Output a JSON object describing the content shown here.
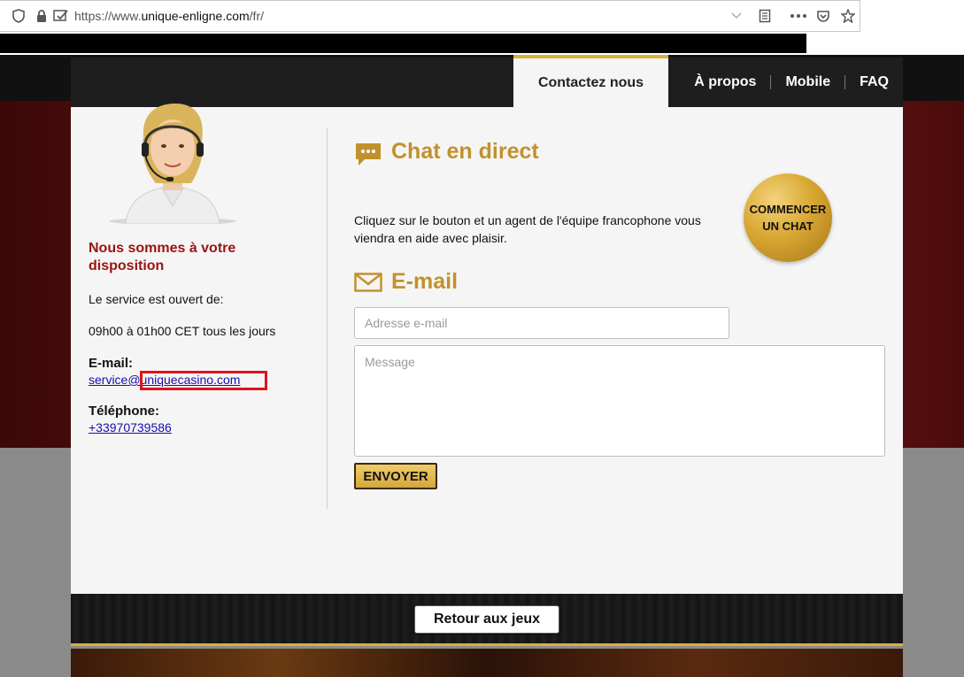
{
  "browser": {
    "url_prefix": "https://www.",
    "url_domain": "unique-enligne.com",
    "url_path": "/fr/"
  },
  "nav": {
    "active": "Contactez nous",
    "items": [
      "À propos",
      "Mobile",
      "FAQ"
    ]
  },
  "left": {
    "title": "Nous sommes à votre disposition",
    "service_open": "Le service est ouvert de:",
    "hours": "09h00 à 01h00 CET tous les jours",
    "email_label": "E-mail:",
    "email_value": "service@uniquecasino.com",
    "phone_label": "Téléphone:",
    "phone_value": "+33970739586"
  },
  "chat": {
    "title": "Chat en direct",
    "description": "Cliquez sur le bouton et un agent de l'équipe francophone vous viendra en aide avec plaisir.",
    "button_line1": "COMMENCER",
    "button_line2": "UN CHAT"
  },
  "email_form": {
    "title": "E-mail",
    "email_placeholder": "Adresse e-mail",
    "message_placeholder": "Message",
    "send_label": "ENVOYER"
  },
  "footer": {
    "back_label": "Retour aux jeux"
  },
  "colors": {
    "gold": "#c2912d",
    "accent_red": "#9b1212",
    "highlight": "#e0121b"
  }
}
